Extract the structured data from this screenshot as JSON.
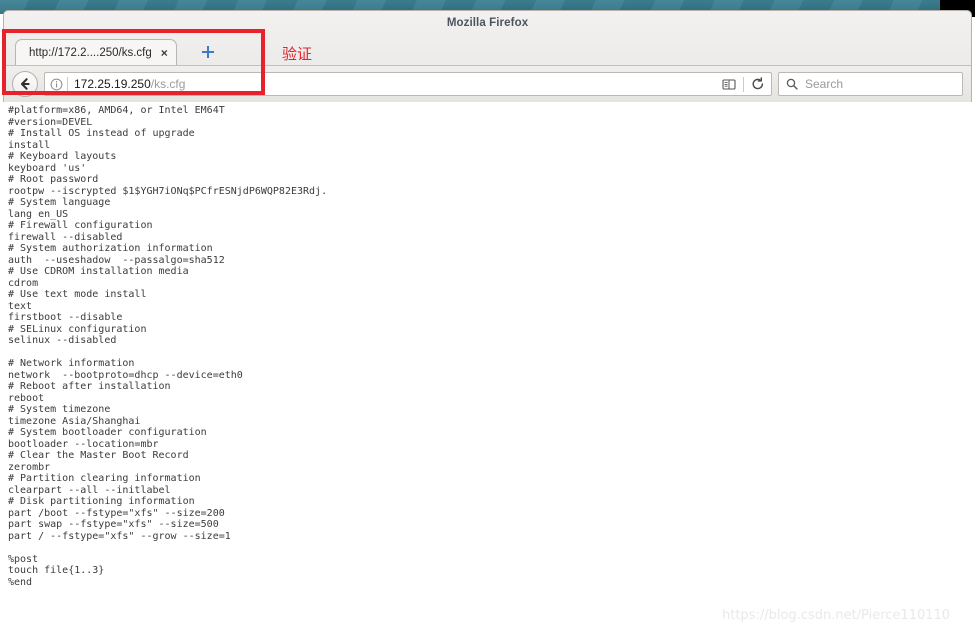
{
  "desktop": {
    "background_color": "#36737f",
    "accent_black": "#000000"
  },
  "window": {
    "title": "Mozilla Firefox"
  },
  "tabs": [
    {
      "label": "http://172.2....250/ks.cfg",
      "close_icon": "×",
      "active": true
    }
  ],
  "new_tab": {
    "icon": "plus-icon",
    "color": "#3b7cc4"
  },
  "toolbar": {
    "back_icon": "back-arrow-icon",
    "identity_icon": "info-circle-icon",
    "url_host": "172.25.19.250",
    "url_path": "/ks.cfg",
    "reader_icon": "reader-mode-icon",
    "reload_icon": "reload-icon",
    "search_icon": "search-icon",
    "search_placeholder": "Search"
  },
  "annotations": {
    "highlight_color": "#e8222a",
    "label": "验证"
  },
  "watermark": {
    "text": "https://blog.csdn.net/Pierce110110"
  },
  "page": {
    "content": "#platform=x86, AMD64, or Intel EM64T\n#version=DEVEL\n# Install OS instead of upgrade\ninstall\n# Keyboard layouts\nkeyboard 'us'\n# Root password\nrootpw --iscrypted $1$YGH7iONq$PCfrESNjdP6WQP82E3Rdj.\n# System language\nlang en_US\n# Firewall configuration\nfirewall --disabled\n# System authorization information\nauth  --useshadow  --passalgo=sha512\n# Use CDROM installation media\ncdrom\n# Use text mode install\ntext\nfirstboot --disable\n# SELinux configuration\nselinux --disabled\n\n# Network information\nnetwork  --bootproto=dhcp --device=eth0\n# Reboot after installation\nreboot\n# System timezone\ntimezone Asia/Shanghai\n# System bootloader configuration\nbootloader --location=mbr\n# Clear the Master Boot Record\nzerombr\n# Partition clearing information\nclearpart --all --initlabel\n# Disk partitioning information\npart /boot --fstype=\"xfs\" --size=200\npart swap --fstype=\"xfs\" --size=500\npart / --fstype=\"xfs\" --grow --size=1\n\n%post\ntouch file{1..3}\n%end"
  }
}
